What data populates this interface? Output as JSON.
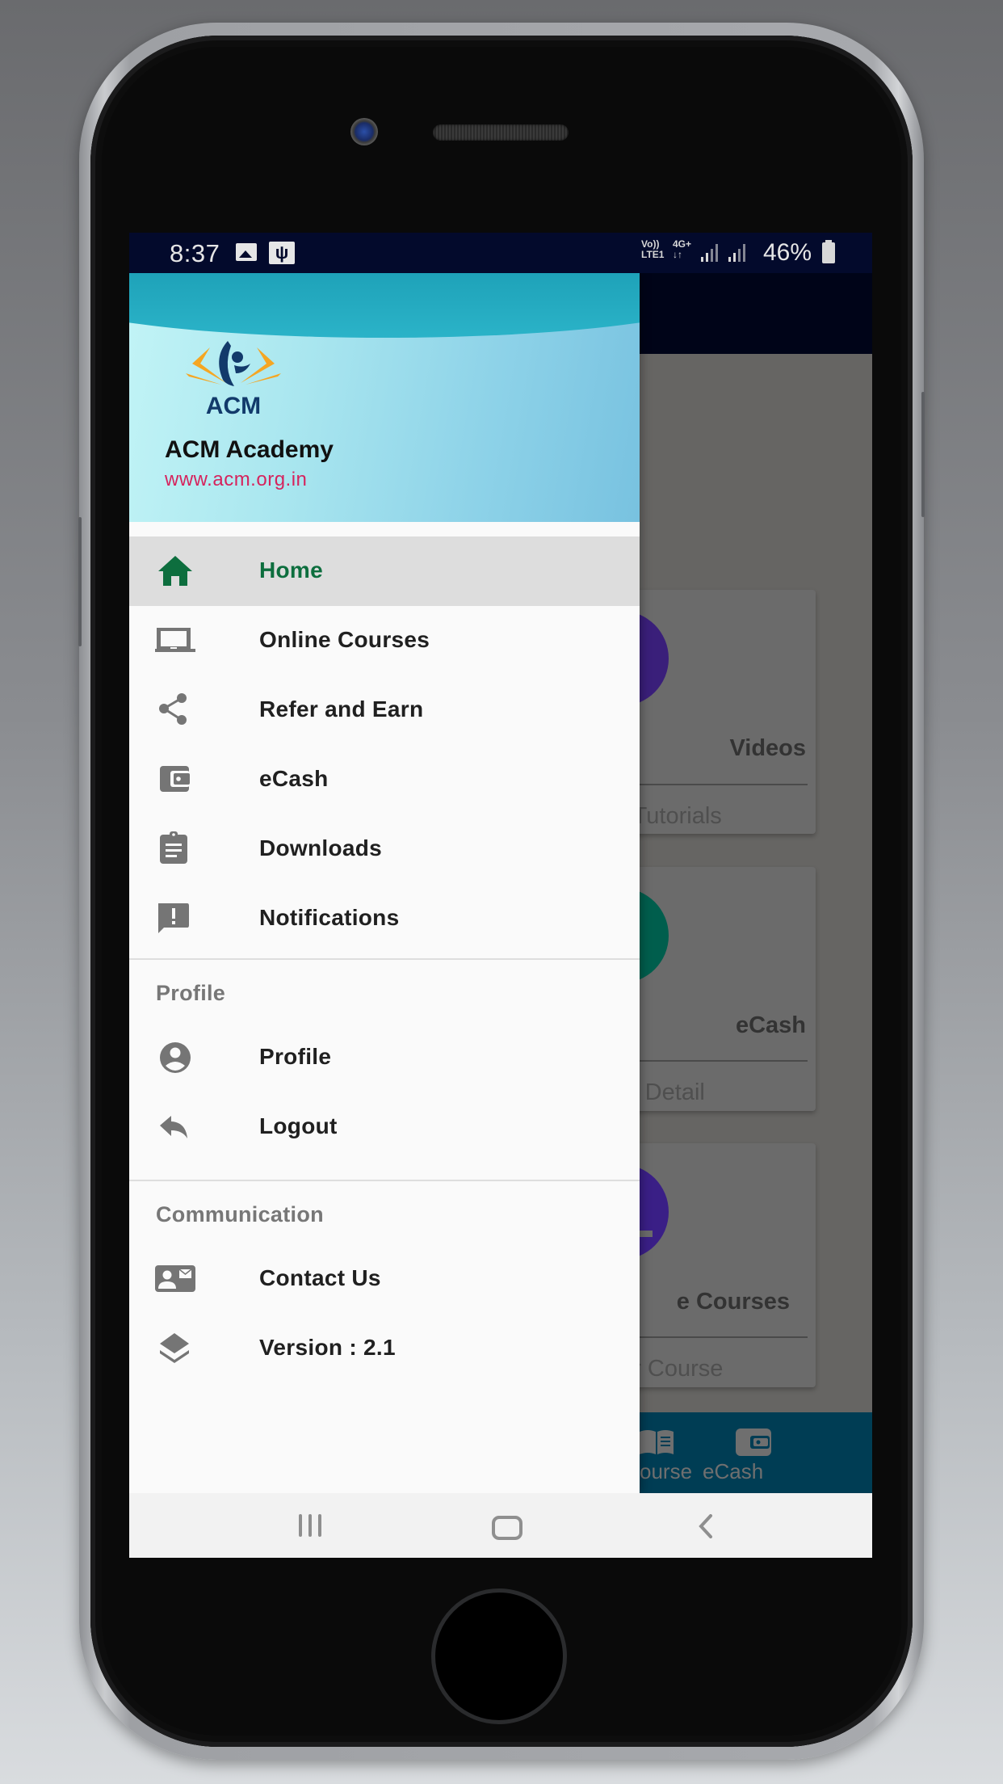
{
  "status_bar": {
    "time": "8:37",
    "network_top": "Vo)) 4G+",
    "network_line1": "Vo))",
    "network_line2": "LTE1",
    "network_4g": "4G+",
    "network_arrows": "↓↑",
    "battery_percent": "46%",
    "icons": [
      "gallery-icon",
      "usb-icon",
      "signal-icon",
      "signal-icon",
      "battery-charging-icon"
    ]
  },
  "drawer": {
    "header": {
      "logo_text": "ACM",
      "title": "ACM Academy",
      "url": "www.acm.org.in",
      "url_color": "#d6235d"
    },
    "menu_items": [
      {
        "label": "Home",
        "icon": "home-icon",
        "active": true
      },
      {
        "label": "Online Courses",
        "icon": "laptop-icon",
        "active": false
      },
      {
        "label": "Refer and Earn",
        "icon": "share-icon",
        "active": false
      },
      {
        "label": "eCash",
        "icon": "wallet-icon",
        "active": false
      },
      {
        "label": "Downloads",
        "icon": "assignment-icon",
        "active": false
      },
      {
        "label": "Notifications",
        "icon": "feedback-icon",
        "active": false
      }
    ],
    "sections": [
      {
        "title": "Profile",
        "items": [
          {
            "label": "Profile",
            "icon": "account-circle-icon"
          },
          {
            "label": "Logout",
            "icon": "reply-icon"
          }
        ]
      },
      {
        "title": "Communication",
        "items": [
          {
            "label": "Contact Us",
            "icon": "contact-mail-icon"
          },
          {
            "label": "Version : 2.1",
            "icon": "layers-icon"
          }
        ]
      }
    ],
    "active_color": "#0d6e3e"
  },
  "background_app": {
    "cards": [
      {
        "title": "Videos",
        "subtitle": "Video Tutorials",
        "visible_title": "Videos",
        "visible_subtitle": "o Tutorials",
        "icon": "videocam-icon",
        "color": "#3a1f7a"
      },
      {
        "title": "eCash",
        "subtitle": "eCash Detail",
        "visible_title": "eCash",
        "visible_subtitle": "sh Detail",
        "icon": "wallet-icon",
        "color": "#005e4d"
      },
      {
        "title": "Online Courses",
        "subtitle": "for Course",
        "visible_title": "e Courses",
        "visible_subtitle": "for Course",
        "icon": "laptop-icon",
        "color": "#3a1f86"
      }
    ],
    "bottom_nav": [
      {
        "label": "Course",
        "visible_label": "ourse",
        "icon": "book-icon"
      },
      {
        "label": "eCash",
        "visible_label": "eCash",
        "icon": "wallet-icon"
      }
    ]
  },
  "system_nav": {
    "buttons": [
      "recent-apps",
      "home",
      "back"
    ]
  }
}
